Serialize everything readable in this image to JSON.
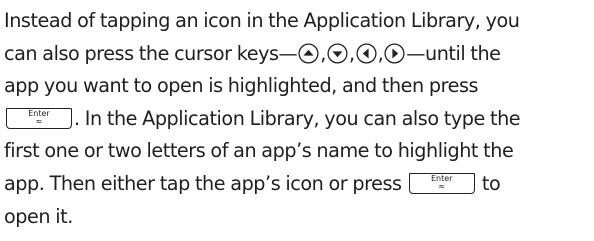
{
  "paragraph": {
    "l1": "Instead of tapping an icon in the Application Library, you",
    "l2a": "can also press the cursor keys—",
    "l2b": ",",
    "l2c": ",",
    "l2d": ",",
    "l2e": "—until the",
    "l3": "app you want to open is highlighted, and then press",
    "l4b": ". In the Application Library, you can also type the",
    "l5": "first one or two letters of an app’s name to highlight the",
    "l6a": "app. Then either tap the app’s icon or press",
    "l6b": "to",
    "l7": "open it."
  },
  "keys": {
    "enter_label": "Enter",
    "enter_sub": "≈",
    "cursor_keys": [
      "up-arrow-key-icon",
      "down-arrow-key-icon",
      "left-arrow-key-icon",
      "right-arrow-key-icon"
    ]
  },
  "colors": {
    "text": "#202020",
    "key_outline": "#222222"
  }
}
